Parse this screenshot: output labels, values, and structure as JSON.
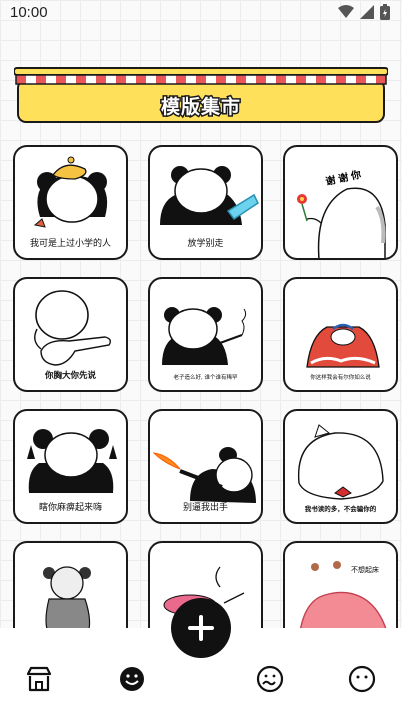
{
  "status_bar": {
    "time": "10:00",
    "icons": [
      "wifi-icon",
      "signal-icon",
      "battery-icon"
    ]
  },
  "banner": {
    "title": "模版集市",
    "colors": {
      "awning_red": "#e95858",
      "board_yellow": "#ffe05a",
      "outline": "#1a1a1a"
    }
  },
  "templates": [
    {
      "caption": "我可是上过小学的人",
      "art": "panda-yellow-hat"
    },
    {
      "caption": "放学别走",
      "art": "panda-blue-blade"
    },
    {
      "caption": "谢谢你",
      "art": "blob-with-flower"
    },
    {
      "caption": "你胸大你先说",
      "art": "blob-pointing"
    },
    {
      "caption": "老子造么好, 谁个谁有稀罕",
      "art": "panda-smoking"
    },
    {
      "caption": "你这样我会有尔你如么说",
      "art": "kid-red-cape"
    },
    {
      "caption": "瞎你麻痹起来嗨",
      "art": "panda-middle-fingers"
    },
    {
      "caption": "别逼我出手",
      "art": "panda-flamethrower"
    },
    {
      "caption": "我书读的多，不会骗你的",
      "art": "cat-red-bowtie"
    },
    {
      "caption": "",
      "art": "girl-pigtails"
    },
    {
      "caption": "",
      "art": "pink-hat-character"
    },
    {
      "caption": "不想起床",
      "art": "pink-blanket"
    }
  ],
  "fab": {
    "icon": "plus-icon"
  },
  "nav": {
    "items": [
      {
        "name": "market",
        "icon": "store-icon",
        "active": false
      },
      {
        "name": "face",
        "icon": "smile-icon",
        "active": true
      },
      {
        "name": "expression",
        "icon": "wavy-face-icon",
        "active": false
      },
      {
        "name": "profile",
        "icon": "neutral-face-icon",
        "active": false
      }
    ]
  }
}
